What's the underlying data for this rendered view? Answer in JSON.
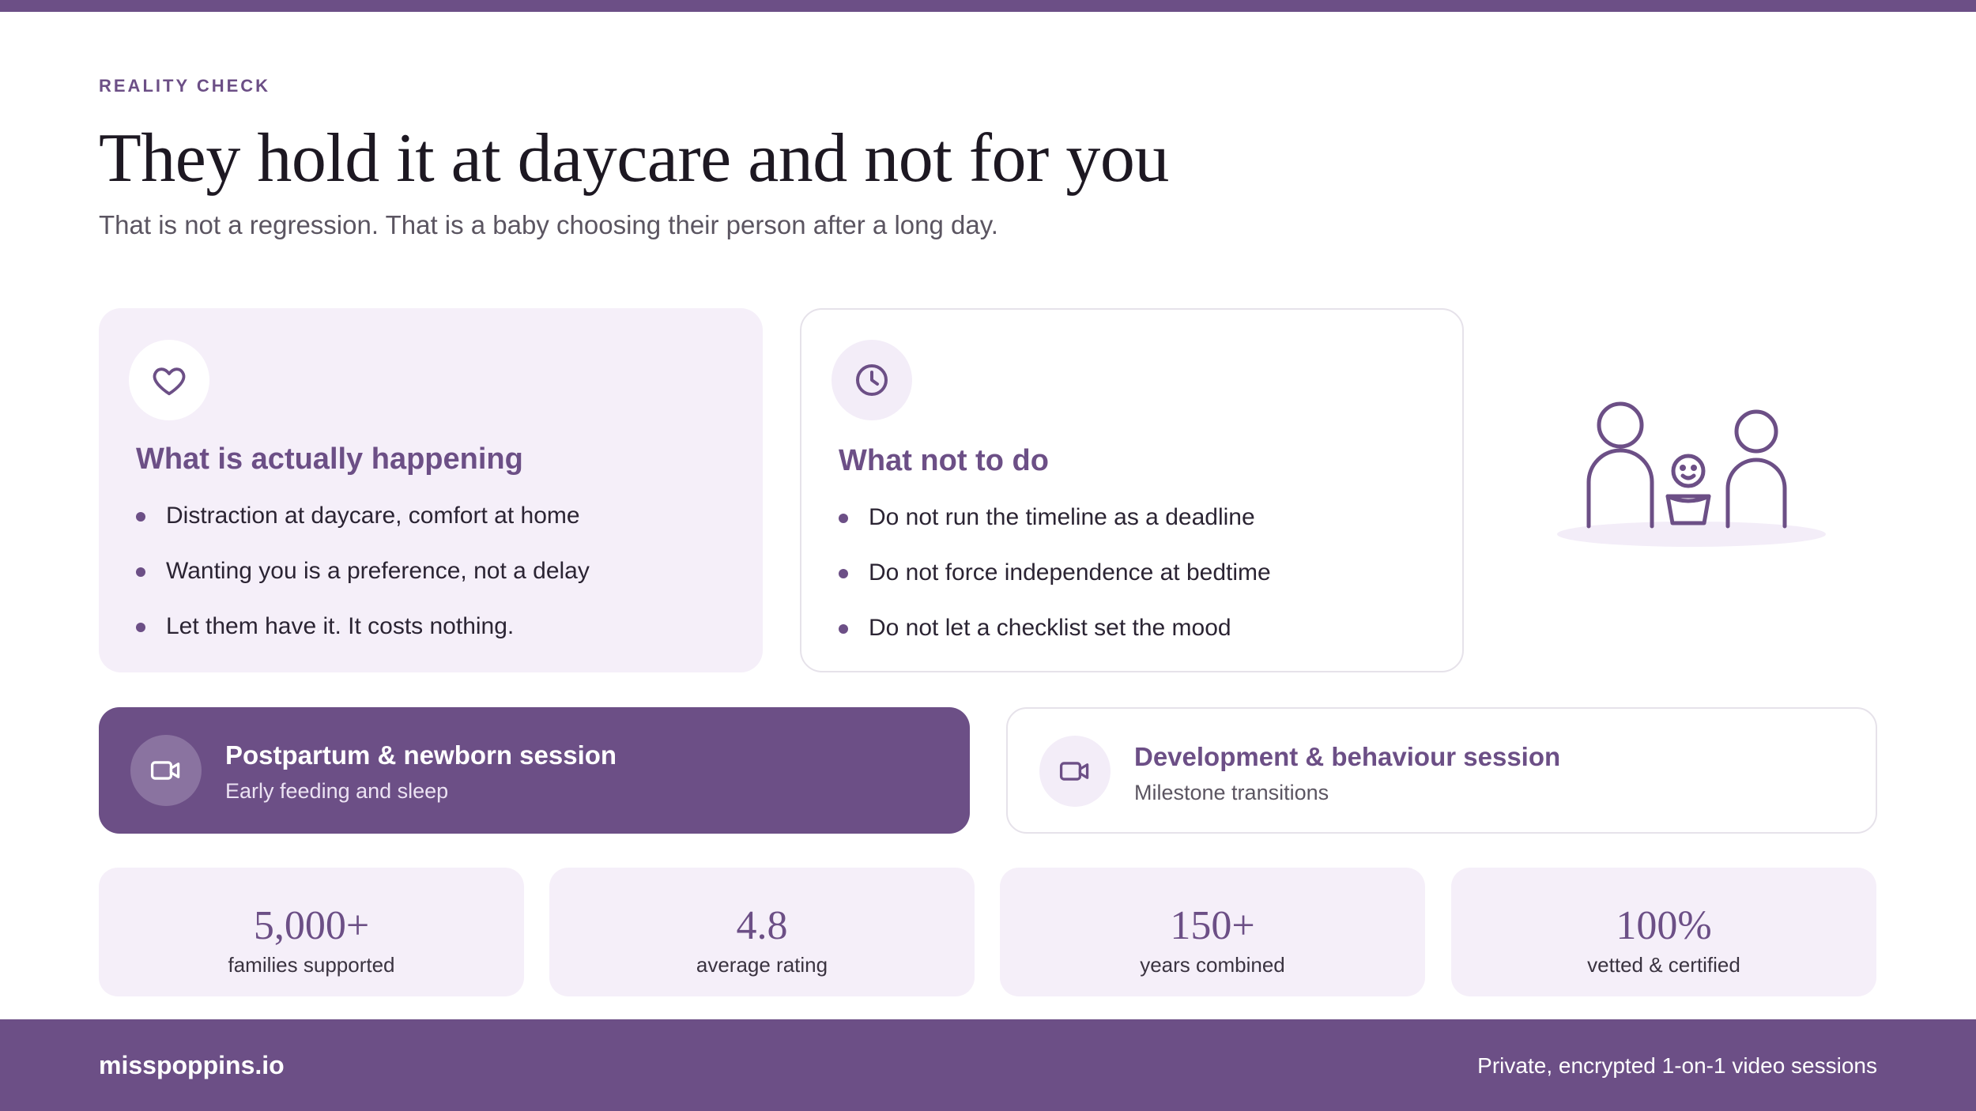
{
  "header": {
    "eyebrow": "REALITY CHECK",
    "title": "They hold it at daycare and not for you",
    "subtitle": "That is not a regression. That is a baby choosing their person after a long day."
  },
  "cards": [
    {
      "icon": "heart-icon",
      "title": "What is actually happening",
      "items": [
        "Distraction at daycare, comfort at home",
        "Wanting you is a preference, not a delay",
        "Let them have it. It costs nothing."
      ]
    },
    {
      "icon": "clock-icon",
      "title": "What not to do",
      "items": [
        "Do not run the timeline as a deadline",
        "Do not force independence at bedtime",
        "Do not let a checklist set the mood"
      ]
    }
  ],
  "illustration": {
    "icon": "family-icon"
  },
  "sessions": [
    {
      "icon": "video-camera-icon",
      "title": "Postpartum & newborn session",
      "subtitle": "Early feeding and sleep"
    },
    {
      "icon": "video-camera-icon",
      "title": "Development & behaviour session",
      "subtitle": "Milestone transitions"
    }
  ],
  "stats": [
    {
      "value": "5,000+",
      "label": "families supported"
    },
    {
      "value": "4.8",
      "label": "average rating"
    },
    {
      "value": "150+",
      "label": "years combined"
    },
    {
      "value": "100%",
      "label": "vetted & certified"
    }
  ],
  "footer": {
    "brand": "misspoppins.io",
    "note": "Private, encrypted 1-on-1 video sessions"
  },
  "colors": {
    "accent": "#6c4f86",
    "card_tint": "#f5eff9"
  }
}
